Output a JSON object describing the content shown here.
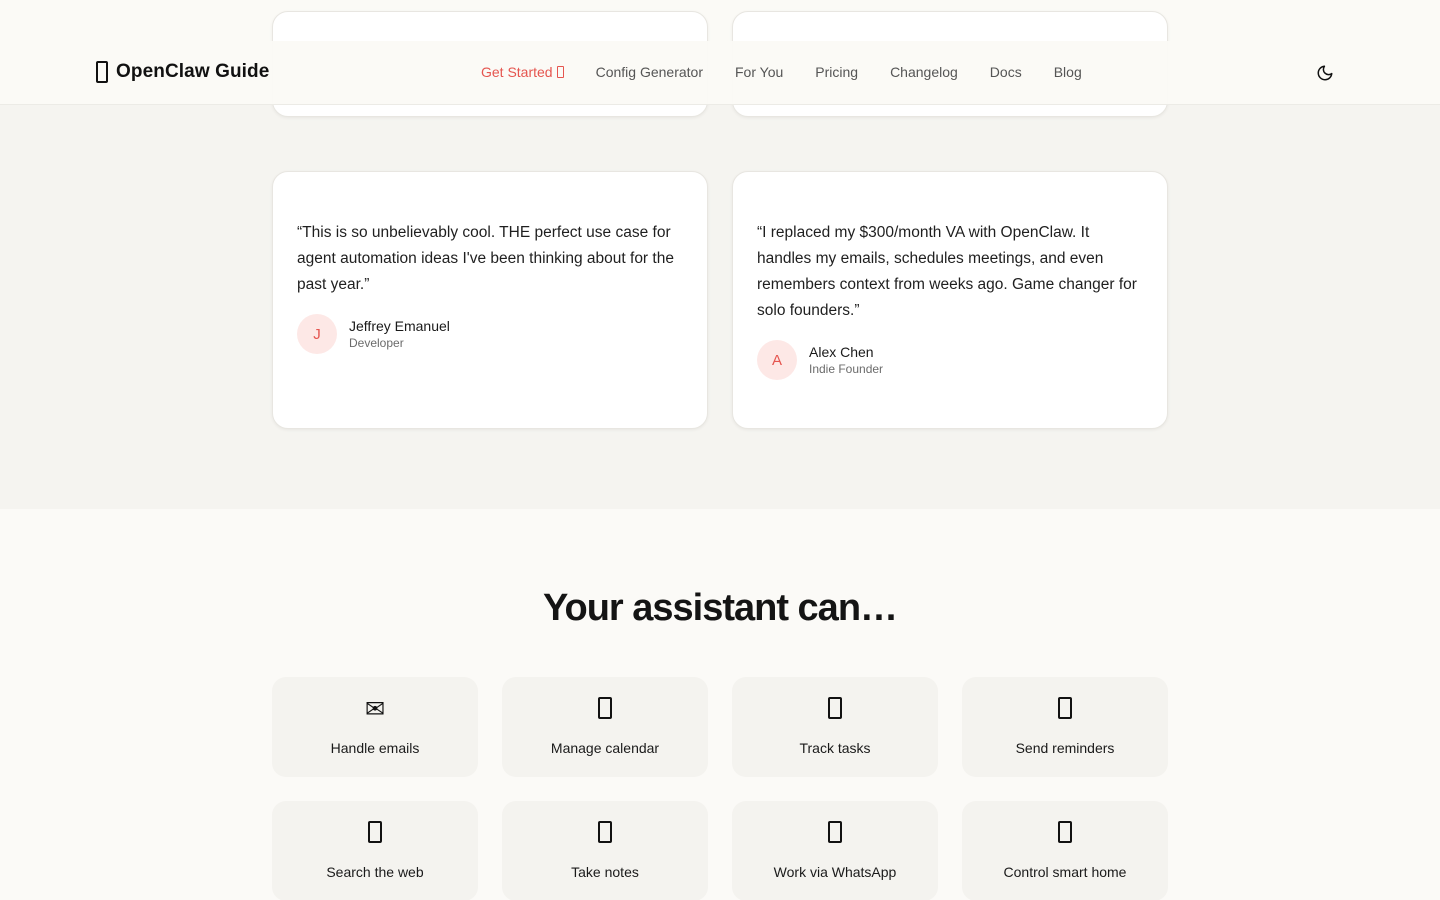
{
  "header": {
    "logo_text": "OpenClaw Guide",
    "nav": [
      {
        "label": "Get Started",
        "active": true
      },
      {
        "label": "Config Generator"
      },
      {
        "label": "For You"
      },
      {
        "label": "Pricing"
      },
      {
        "label": "Changelog"
      },
      {
        "label": "Docs"
      },
      {
        "label": "Blog"
      }
    ],
    "theme_icon": "moon-icon"
  },
  "testimonials": [
    {
      "quote": "“This is so unbelievably cool. THE perfect use case for agent automation ideas I've been thinking about for the past year.”",
      "initial": "J",
      "name": "Jeffrey Emanuel",
      "role": "Developer"
    },
    {
      "quote": "“I replaced my $300/month VA with OpenClaw. It handles my emails, schedules meetings, and even remembers context from weeks ago. Game changer for solo founders.”",
      "initial": "A",
      "name": "Alex Chen",
      "role": "Indie Founder"
    }
  ],
  "capabilities": {
    "title": "Your assistant can…",
    "items": [
      {
        "label": "Handle emails",
        "icon": "envelope-icon",
        "glyph": "✉"
      },
      {
        "label": "Manage calendar",
        "icon": "calendar-icon"
      },
      {
        "label": "Track tasks",
        "icon": "checklist-icon"
      },
      {
        "label": "Send reminders",
        "icon": "bell-icon"
      },
      {
        "label": "Search the web",
        "icon": "magnifier-icon"
      },
      {
        "label": "Take notes",
        "icon": "notepad-icon"
      },
      {
        "label": "Work via WhatsApp",
        "icon": "phone-icon"
      },
      {
        "label": "Control smart home",
        "icon": "house-icon"
      }
    ]
  },
  "colors": {
    "accent": "#e5554f",
    "card_bg": "#ffffff",
    "section_bg": "#f5f4f0",
    "tile_bg": "#f4f3ef"
  }
}
